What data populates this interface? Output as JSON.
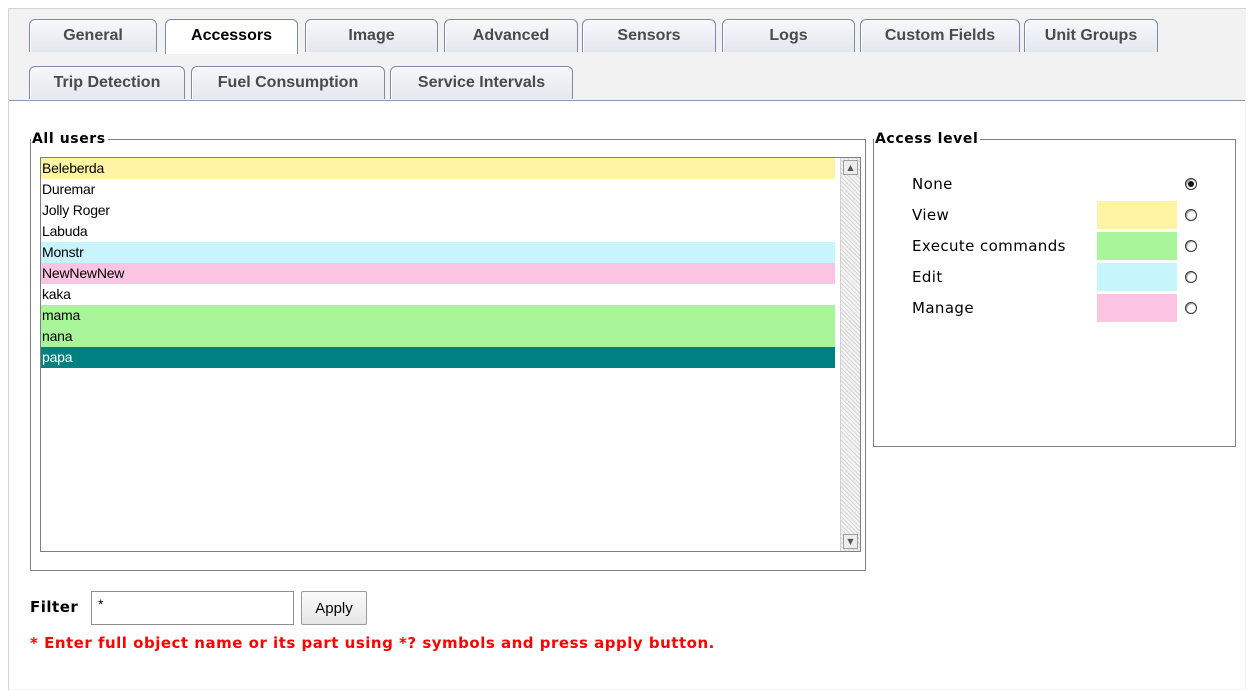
{
  "tabs_row1": [
    {
      "label": "General"
    },
    {
      "label": "Accessors",
      "active": true
    },
    {
      "label": "Image"
    },
    {
      "label": "Advanced"
    },
    {
      "label": "Sensors"
    },
    {
      "label": "Logs"
    },
    {
      "label": "Custom Fields"
    },
    {
      "label": "Unit Groups"
    }
  ],
  "tabs_row2": [
    {
      "label": "Trip Detection"
    },
    {
      "label": "Fuel Consumption"
    },
    {
      "label": "Service Intervals"
    }
  ],
  "users_panel": {
    "legend": "All users",
    "users": [
      {
        "name": "Beleberda",
        "access": "view"
      },
      {
        "name": "Duremar",
        "access": "none"
      },
      {
        "name": "Jolly Roger",
        "access": "none"
      },
      {
        "name": "Labuda",
        "access": "none"
      },
      {
        "name": "Monstr",
        "access": "edit"
      },
      {
        "name": "NewNewNew",
        "access": "manage"
      },
      {
        "name": "kaka",
        "access": "none"
      },
      {
        "name": "mama",
        "access": "execute"
      },
      {
        "name": "nana",
        "access": "execute"
      },
      {
        "name": "papa",
        "access": "selected"
      }
    ]
  },
  "access_panel": {
    "legend": "Access level",
    "levels": [
      {
        "label": "None",
        "color": null,
        "checked": true
      },
      {
        "label": "View",
        "color": "#fff4a3",
        "checked": false
      },
      {
        "label": "Execute commands",
        "color": "#a8f59a",
        "checked": false
      },
      {
        "label": "Edit",
        "color": "#c6f6fc",
        "checked": false
      },
      {
        "label": "Manage",
        "color": "#fcc4e2",
        "checked": false
      }
    ]
  },
  "access_colors": {
    "none": "#ffffff",
    "view": "#fff4a3",
    "execute": "#a8f59a",
    "edit": "#c6f6fc",
    "manage": "#fcc4e2",
    "selected": "#008080"
  },
  "filter": {
    "label": "Filter",
    "value": "*",
    "apply_label": "Apply",
    "hint": "* Enter full object name or its part using *? symbols and press apply button."
  },
  "icons": {
    "scroll_up": "scroll-up-arrow-icon",
    "scroll_down": "scroll-down-arrow-icon"
  }
}
